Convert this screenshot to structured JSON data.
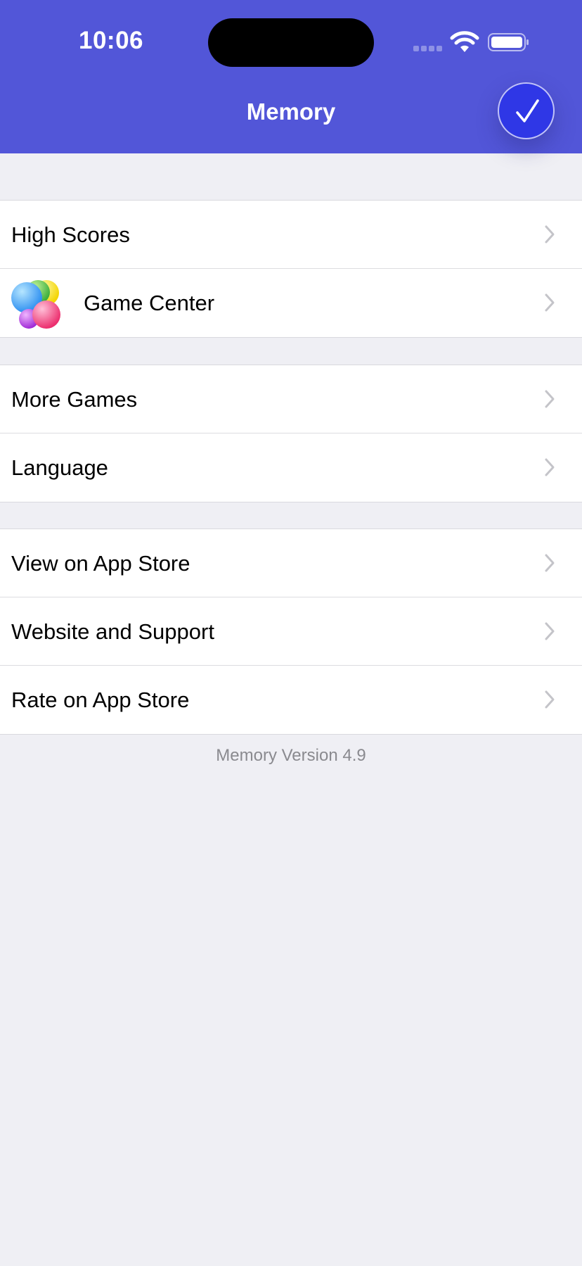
{
  "status_bar": {
    "time": "10:06"
  },
  "nav": {
    "title": "Memory",
    "done_icon": "checkmark-icon"
  },
  "groups": [
    [
      {
        "label": "High Scores"
      },
      {
        "label": "Game Center",
        "icon": "game-center-icon"
      }
    ],
    [
      {
        "label": "More Games"
      },
      {
        "label": "Language"
      }
    ],
    [
      {
        "label": "View on App Store"
      },
      {
        "label": "Website and Support"
      },
      {
        "label": "Rate on App Store"
      }
    ]
  ],
  "footer": {
    "version": "Memory Version 4.9"
  },
  "colors": {
    "header": "#5256d8",
    "done_button": "#2f37e6",
    "background": "#efeff4"
  }
}
